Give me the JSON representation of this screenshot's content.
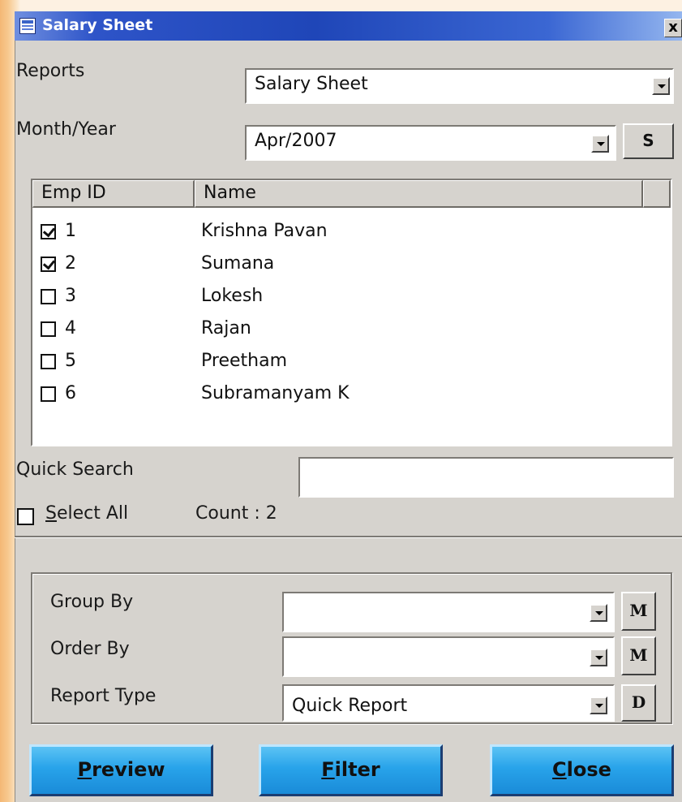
{
  "window": {
    "title": "Salary Sheet",
    "close_label": "x"
  },
  "reports": {
    "label": "Reports",
    "value": "Salary Sheet"
  },
  "month_year": {
    "label": "Month/Year",
    "value": "Apr/2007",
    "s_button": "S"
  },
  "list": {
    "columns": [
      "Emp ID",
      "Name"
    ],
    "rows": [
      {
        "id": "1",
        "name": "Krishna Pavan",
        "checked": true
      },
      {
        "id": "2",
        "name": "Sumana",
        "checked": true
      },
      {
        "id": "3",
        "name": "Lokesh",
        "checked": false
      },
      {
        "id": "4",
        "name": "Rajan",
        "checked": false
      },
      {
        "id": "5",
        "name": "Preetham",
        "checked": false
      },
      {
        "id": "6",
        "name": "Subramanyam K",
        "checked": false
      }
    ]
  },
  "quick_search": {
    "label": "Quick Search",
    "value": ""
  },
  "select_all": {
    "label_underline": "S",
    "label_rest": "elect All",
    "checked": false
  },
  "count": {
    "text": "Count : 2"
  },
  "options": {
    "group_by": {
      "label": "Group By",
      "value": "",
      "button": "M"
    },
    "order_by": {
      "label": "Order By",
      "value": "",
      "button": "M"
    },
    "report_type": {
      "label": "Report Type",
      "value": "Quick Report",
      "button": "D"
    }
  },
  "buttons": {
    "preview": {
      "underline": "P",
      "rest": "review"
    },
    "filter": {
      "underline": "F",
      "rest": "ilter"
    },
    "close": {
      "underline": "C",
      "rest": "lose"
    }
  },
  "colors": {
    "title_bar": "#1f46b8",
    "button_blue": "#28a3ea",
    "window_bg": "#d6d3ce"
  }
}
